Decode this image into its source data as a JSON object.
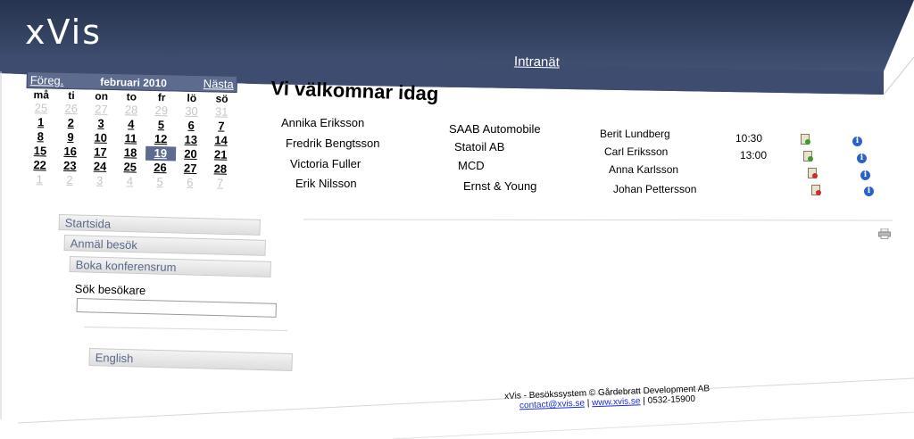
{
  "header": {
    "logo": "xVis",
    "nav_link": "Intranät"
  },
  "calendar": {
    "prev": "Föreg.",
    "month": "februari 2010",
    "next": "Nästa",
    "weekdays": [
      "må",
      "ti",
      "on",
      "to",
      "fr",
      "lö",
      "sö"
    ],
    "weeks": [
      [
        "25",
        "26",
        "27",
        "28",
        "29",
        "30",
        "31"
      ],
      [
        "1",
        "2",
        "3",
        "4",
        "5",
        "6",
        "7"
      ],
      [
        "8",
        "9",
        "10",
        "11",
        "12",
        "13",
        "14"
      ],
      [
        "15",
        "16",
        "17",
        "18",
        "19",
        "20",
        "21"
      ],
      [
        "22",
        "23",
        "24",
        "25",
        "26",
        "27",
        "28"
      ],
      [
        "1",
        "2",
        "3",
        "4",
        "5",
        "6",
        "7"
      ]
    ],
    "selected": "19"
  },
  "menu": {
    "items": [
      "Startsida",
      "Anmäl besök",
      "Boka konferensrum"
    ],
    "search_label": "Sök besökare",
    "language": "English"
  },
  "main": {
    "title": "Vi välkomnar idag",
    "visitors": [
      {
        "name": "Annika Eriksson",
        "company": "SAAB Automobile",
        "host": "Berit Lundberg",
        "time": "10:30"
      },
      {
        "name": "Fredrik Bengtsson",
        "company": "Statoil AB",
        "host": "Carl Eriksson",
        "time": "13:00"
      },
      {
        "name": "Victoria Fuller",
        "company": "MCD",
        "host": "Anna Karlsson",
        "time": ""
      },
      {
        "name": "Erik Nilsson",
        "company": "Ernst & Young",
        "host": "Johan Pettersson",
        "time": ""
      }
    ]
  },
  "footer": {
    "line1": "xVis - Besökssystem © Gårdebratt Development AB",
    "email": "contact@xvis.se",
    "separator": " | ",
    "site": "www.xvis.se",
    "phone": " | 0532-15900"
  },
  "colors": {
    "header": "#3e4d6f",
    "accent": "#5d6b8e",
    "link": "#1a31d6"
  }
}
